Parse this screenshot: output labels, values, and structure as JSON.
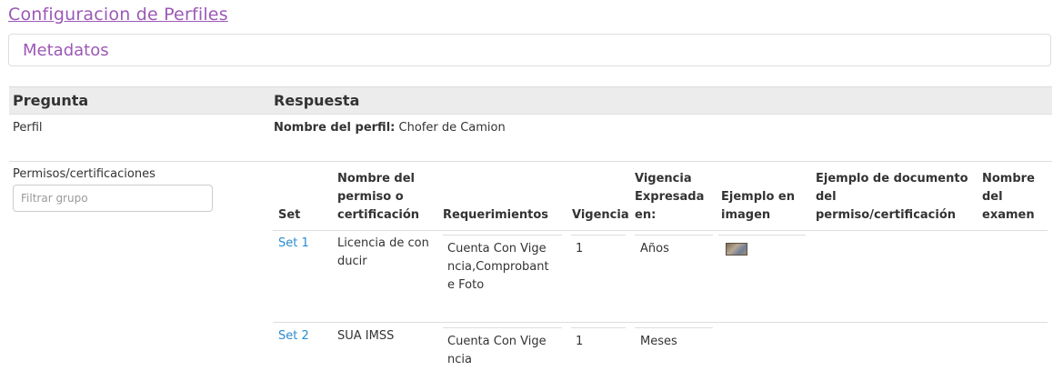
{
  "page": {
    "title": "Configuracion de Perfiles",
    "panel_title": "Metadatos"
  },
  "table": {
    "col_pregunta": "Pregunta",
    "col_respuesta": "Respuesta"
  },
  "perfil": {
    "label": "Perfil",
    "name_label": "Nombre del perfil:",
    "name_value": "Chofer de Camion"
  },
  "permisos": {
    "label": "Permisos/certificaciones",
    "filter_placeholder": "Filtrar grupo",
    "headers": {
      "set": "Set",
      "nombre_1": "Nombre del",
      "nombre_2": "permiso o",
      "nombre_3": "certificación",
      "requerimientos": "Requerimientos",
      "vigencia": "Vigencia",
      "vig_exp_1": "Vigencia",
      "vig_exp_2": "Expresada",
      "vig_exp_3": "en:",
      "ejemplo_img_1": "Ejemplo en",
      "ejemplo_img_2": "imagen",
      "ejemplo_doc_1": "Ejemplo de documento",
      "ejemplo_doc_2": "del",
      "ejemplo_doc_3": "permiso/certificación",
      "examen_1": "Nombre",
      "examen_2": "del",
      "examen_3": "examen"
    },
    "rows": [
      {
        "set": "Set 1",
        "nombre_1": "Licencia de con",
        "nombre_2": "ducir",
        "req_1": "Cuenta Con Vige",
        "req_2": "ncia,Comprobant",
        "req_3": "e Foto",
        "vigencia": "1",
        "expresada": "Años"
      },
      {
        "set": "Set 2",
        "nombre_1": "SUA IMSS",
        "req_1": "Cuenta Con Vige",
        "req_2": "ncia",
        "vigencia": "1",
        "expresada": "Meses"
      }
    ]
  }
}
